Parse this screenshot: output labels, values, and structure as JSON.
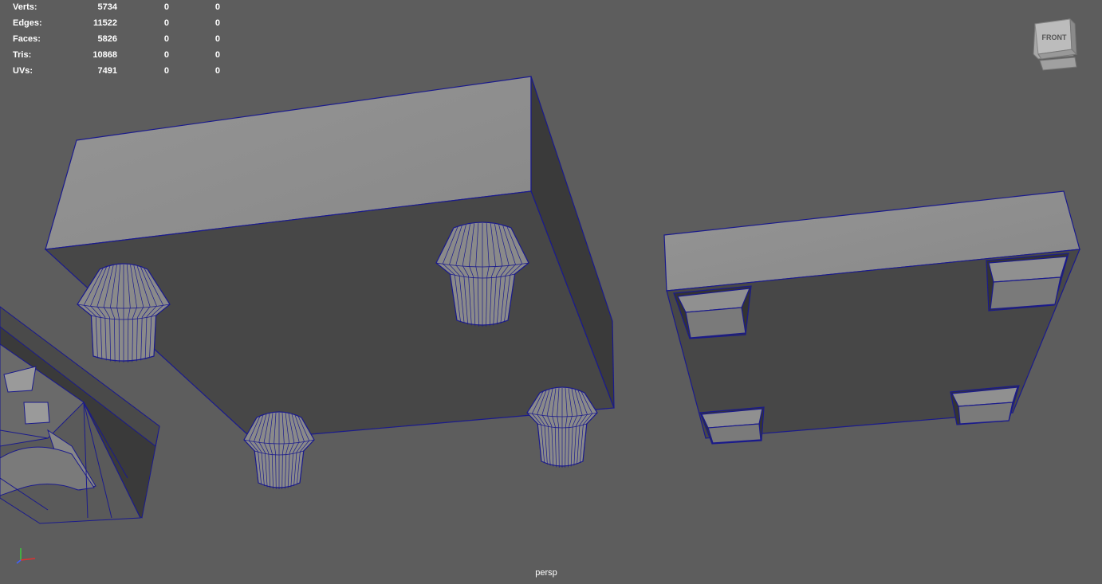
{
  "hud": {
    "rows": [
      {
        "label": "Verts:",
        "count": "5734",
        "selected": "0",
        "extra": "0"
      },
      {
        "label": "Edges:",
        "count": "11522",
        "selected": "0",
        "extra": "0"
      },
      {
        "label": "Faces:",
        "count": "5826",
        "selected": "0",
        "extra": "0"
      },
      {
        "label": "Tris:",
        "count": "10868",
        "selected": "0",
        "extra": "0"
      },
      {
        "label": "UVs:",
        "count": "7491",
        "selected": "0",
        "extra": "0"
      }
    ]
  },
  "viewcube": {
    "face_label": "FRONT"
  },
  "camera": {
    "name": "persp"
  },
  "colors": {
    "background": "#5d5d5d",
    "wireframe": "#1a1a8c",
    "face_light": "#8e8e8e",
    "face_dark": "#3f3f3f",
    "face_mid": "#505050",
    "text": "#ffffff"
  },
  "icons": {
    "viewcube": "viewcube-icon",
    "axis": "axis-gizmo-icon"
  }
}
